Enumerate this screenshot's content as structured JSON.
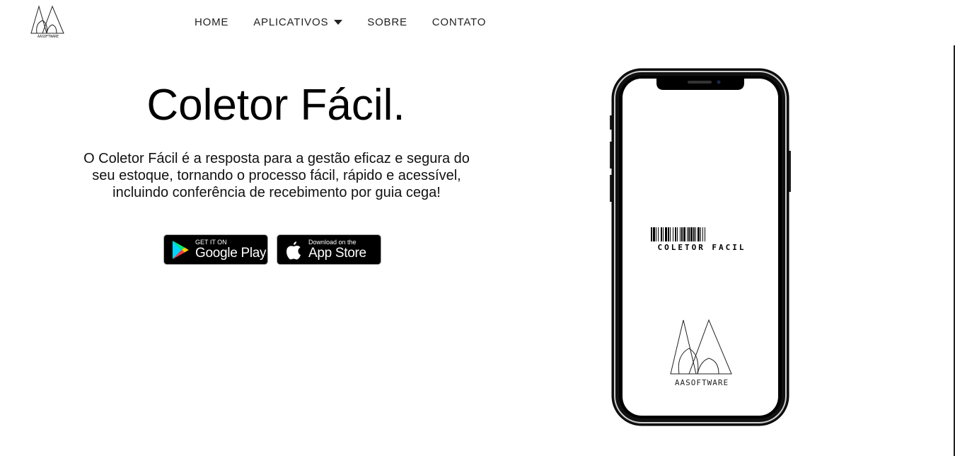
{
  "brand": {
    "logo_text": "AASOFTWARE",
    "icon": "aasoftware-logo-icon"
  },
  "nav": {
    "items": [
      {
        "label": "HOME"
      },
      {
        "label": "APLICATIVOS",
        "icon": "caret-down-icon"
      },
      {
        "label": "SOBRE"
      },
      {
        "label": "CONTATO"
      }
    ]
  },
  "hero": {
    "title": "Coletor Fácil.",
    "description": "O Coletor Fácil é a resposta para a gestão eficaz e segura do seu estoque, tornando o processo fácil, rápido e acessível, incluindo conferência de recebimento por guia cega!"
  },
  "stores": {
    "google_play": {
      "small": "GET IT ON",
      "big": "Google Play",
      "icon": "google-play-icon"
    },
    "app_store": {
      "small": "Download on the",
      "big": "App Store",
      "icon": "apple-icon"
    }
  },
  "phone": {
    "barcode_label": "COLETOR FACIL",
    "splash_logo_text": "AASOFTWARE",
    "colors": {
      "frame": "#000000",
      "screen": "#ffffff"
    }
  }
}
